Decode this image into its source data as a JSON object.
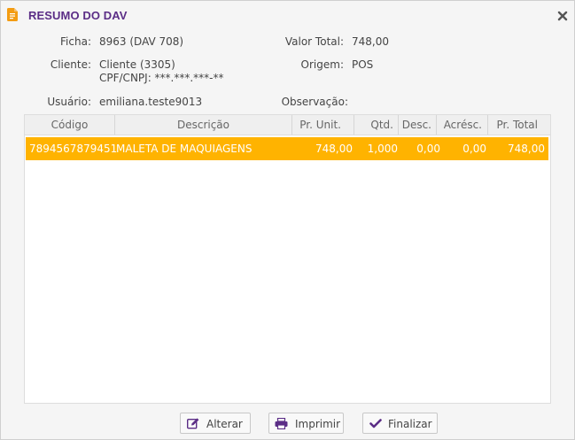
{
  "dialog": {
    "title": "RESUMO DO DAV"
  },
  "summary": {
    "ficha_label": "Ficha:",
    "ficha_value": "8963 (DAV 708)",
    "cliente_label": "Cliente:",
    "cliente_value": "Cliente (3305)",
    "cpf_value": "CPF/CNPJ: ***.***.***-**",
    "usuario_label": "Usuário:",
    "usuario_value": "emiliana.teste9013",
    "valor_total_label": "Valor Total:",
    "valor_total_value": "748,00",
    "origem_label": "Origem:",
    "origem_value": "POS",
    "observacao_label": "Observação:",
    "observacao_value": ""
  },
  "table": {
    "columns": [
      "Código",
      "Descrição",
      "Pr. Unit.",
      "Qtd.",
      "Desc.",
      "Acrésc.",
      "Pr. Total"
    ],
    "rows": [
      {
        "codigo": "7894567879451",
        "descricao": "MALETA DE MAQUIAGENS",
        "pr_unit": "748,00",
        "qtd": "1,000",
        "desc": "0,00",
        "acresc": "0,00",
        "pr_total": "748,00"
      }
    ],
    "selected_row_color": "#ffb300"
  },
  "buttons": {
    "alterar": "Alterar",
    "imprimir": "Imprimir",
    "finalizar": "Finalizar"
  },
  "colors": {
    "title": "#5b2d86",
    "accent_icon": "#f39c12"
  }
}
